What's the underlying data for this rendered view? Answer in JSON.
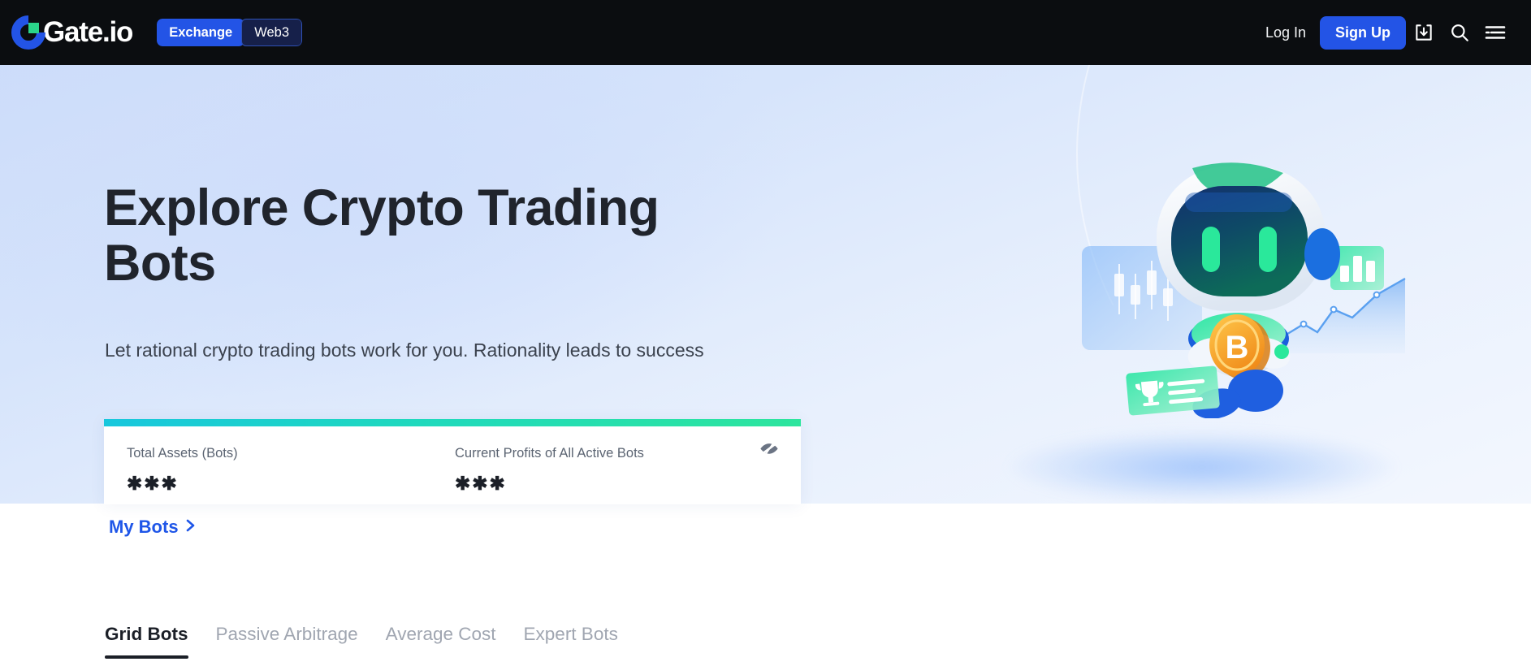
{
  "header": {
    "brand_name": "Gate.io",
    "logo_icon": "gate-logo-icon",
    "segments": [
      {
        "label": "Exchange",
        "active": true
      },
      {
        "label": "Web3",
        "active": false
      }
    ],
    "login_label": "Log In",
    "signup_label": "Sign Up",
    "icons": [
      {
        "name": "download-icon"
      },
      {
        "name": "search-icon"
      },
      {
        "name": "menu-icon"
      }
    ],
    "background_color": "#0b0d10",
    "accent_color": "#2354e6"
  },
  "hero": {
    "title": "Explore Crypto Trading Bots",
    "subtitle": "Let rational crypto trading bots work for you. Rationality leads to success",
    "illustration": "trading-robot-illustration",
    "gradient_from": "#ccdcfa",
    "gradient_to": "#f3f7fe"
  },
  "stats_card": {
    "bar_gradient_from": "#18c7dd",
    "bar_gradient_to": "#2de59d",
    "visibility_icon": "eye-off-icon",
    "stats": [
      {
        "label": "Total Assets (Bots)",
        "value": "✱✱✱"
      },
      {
        "label": "Current Profits of All Active Bots",
        "value": "✱✱✱"
      }
    ],
    "my_bots_label": "My Bots",
    "my_bots_chevron": "chevron-right-icon",
    "link_color": "#1f56e8"
  },
  "tabs": [
    {
      "label": "Grid Bots",
      "active": true
    },
    {
      "label": "Passive Arbitrage",
      "active": false
    },
    {
      "label": "Average Cost",
      "active": false
    },
    {
      "label": "Expert Bots",
      "active": false
    }
  ]
}
